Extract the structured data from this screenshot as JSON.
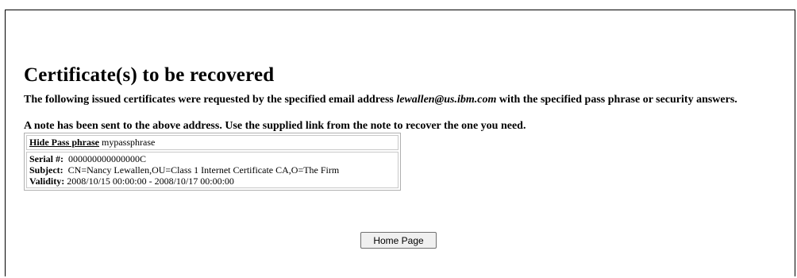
{
  "page": {
    "title": "Certificate(s) to be recovered",
    "intro_prefix": "The following issued certificates were requested by the specified email address ",
    "email": "lewallen@us.ibm.com",
    "intro_suffix": " with the specified pass phrase or security answers.",
    "note": "A note has been sent to the above address. Use the supplied link from the note to recover the one you need."
  },
  "certificate": {
    "hide_pass_label": "Hide Pass phrase",
    "pass_phrase": "mypassphrase",
    "serial_label": "Serial #:",
    "serial_value": "000000000000000C",
    "subject_label": "Subject:",
    "subject_value": "CN=Nancy Lewallen,OU=Class 1 Internet Certificate CA,O=The Firm",
    "validity_label": "Validity:",
    "validity_value": "2008/10/15 00:00:00 - 2008/10/17 00:00:00"
  },
  "actions": {
    "home_label": "Home Page"
  }
}
